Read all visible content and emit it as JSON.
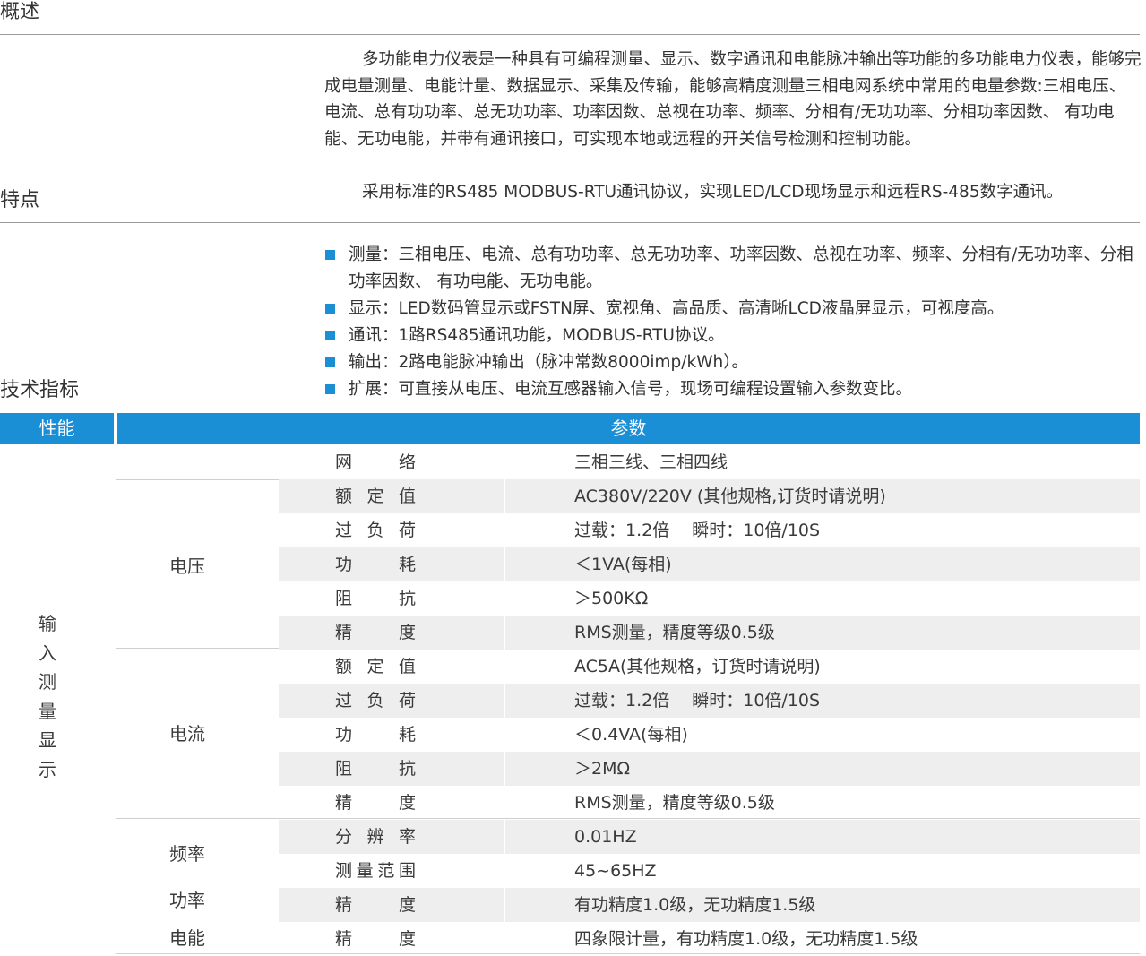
{
  "sections": {
    "overview": "概述",
    "features": "特点",
    "specs": "技术指标"
  },
  "overview": {
    "para1": "多功能电力仪表是一种具有可编程测量、显示、数字通讯和电能脉冲输出等功能的多功能电力仪表，能够完成电量测量、电能计量、数据显示、采集及传输，能够高精度测量三相电网系统中常用的电量参数:三相电压、电流、总有功功率、总无功功率、功率因数、总视在功率、频率、分相有/无功功率、分相功率因数、 有功电能、无功电能，并带有通讯接口，可实现本地或远程的开关信号检测和控制功能。",
    "para2": "采用标准的RS485 MODBUS-RTU通讯协议，实现LED/LCD现场显示和远程RS-485数字通讯。"
  },
  "features": {
    "item1": "测量：三相电压、电流、总有功功率、总无功功率、功率因数、总视在功率、频率、分相有/无功功率、分相功率因数、 有功电能、无功电能。",
    "item2": "显示：LED数码管显示或FSTN屏、宽视角、高品质、高清晰LCD液晶屏显示，可视度高。",
    "item3": "通讯：1路RS485通讯功能，MODBUS-RTU协议。",
    "item4": "输出：2路电能脉冲输出（脉冲常数8000imp/kWh）。",
    "item5": "扩展：可直接从电压、电流互感器输入信号，现场可编程设置输入参数变比。"
  },
  "table": {
    "header": {
      "col1": "性能",
      "col2": "参数"
    },
    "category": "输入测量显示",
    "groups": {
      "voltage": "电压",
      "current": "电流",
      "frequency": "频率",
      "power": "功率",
      "energy": "电能"
    },
    "rows": [
      {
        "name": "网络",
        "value": "三相三线、三相四线"
      },
      {
        "name": "额定值",
        "value": "AC380V/220V (其他规格,订货时请说明)"
      },
      {
        "name": "过负荷",
        "value": "过载：1.2倍 　瞬时：10倍/10S"
      },
      {
        "name": "功耗",
        "value": "＜1VA(每相)"
      },
      {
        "name": "阻抗",
        "value": "＞500KΩ"
      },
      {
        "name": "精度",
        "value": "RMS测量，精度等级0.5级"
      },
      {
        "name": "额定值",
        "value": "AC5A(其他规格，订货时请说明)"
      },
      {
        "name": "过负荷",
        "value": "过载：1.2倍 　瞬时：10倍/10S"
      },
      {
        "name": "功耗",
        "value": "＜0.4VA(每相)"
      },
      {
        "name": "阻抗",
        "value": "＞2MΩ"
      },
      {
        "name": "精度",
        "value": "RMS测量，精度等级0.5级"
      },
      {
        "name": "分辨率",
        "value": "0.01HZ"
      },
      {
        "name": "测量范围",
        "value": "45~65HZ"
      },
      {
        "name": "精度",
        "value": "有功精度1.0级，无功精度1.5级"
      },
      {
        "name": "精度",
        "value": "四象限计量，有功精度1.0级，无功精度1.5级"
      }
    ]
  },
  "colors": {
    "accent": "#1a8fd6",
    "row_shade": "#eeeeee",
    "text": "#3a3a3a"
  }
}
